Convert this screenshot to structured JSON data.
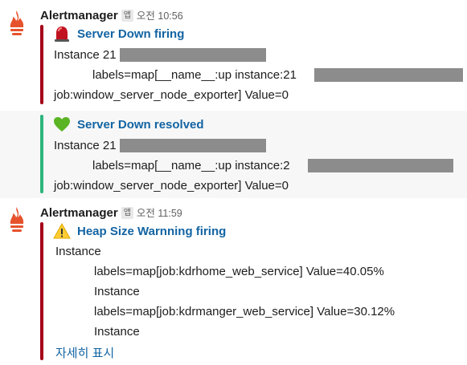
{
  "colors": {
    "firing_bar": "#a40019",
    "resolved_bar": "#2eb67d",
    "warning_bar": "#a40019",
    "link": "#1264a3"
  },
  "messages": [
    {
      "sender": "Alertmanager",
      "app_badge": "앱",
      "time": "오전 10:56",
      "attachment": {
        "emoji": "rotating-light-icon",
        "title": "Server Down firing",
        "lines": [
          "Instance 21",
          "labels=map[__name__:up instance:21",
          "job:window_server_node_exporter] Value=0"
        ]
      }
    },
    {
      "attachment": {
        "emoji": "green-heart-icon",
        "title": "Server Down resolved",
        "lines": [
          "Instance 21",
          "labels=map[__name__:up instance:2",
          "job:window_server_node_exporter] Value=0"
        ]
      }
    },
    {
      "sender": "Alertmanager",
      "app_badge": "앱",
      "time": "오전 11:59",
      "attachment": {
        "emoji": "warning-icon",
        "title": "Heap Size Warnning firing",
        "lines": [
          "Instance",
          "labels=map[job:kdrhome_web_service] Value=40.05%",
          "Instance",
          "labels=map[job:kdrmanger_web_service] Value=30.12%",
          "Instance"
        ],
        "show_more": "자세히 표시"
      }
    }
  ]
}
